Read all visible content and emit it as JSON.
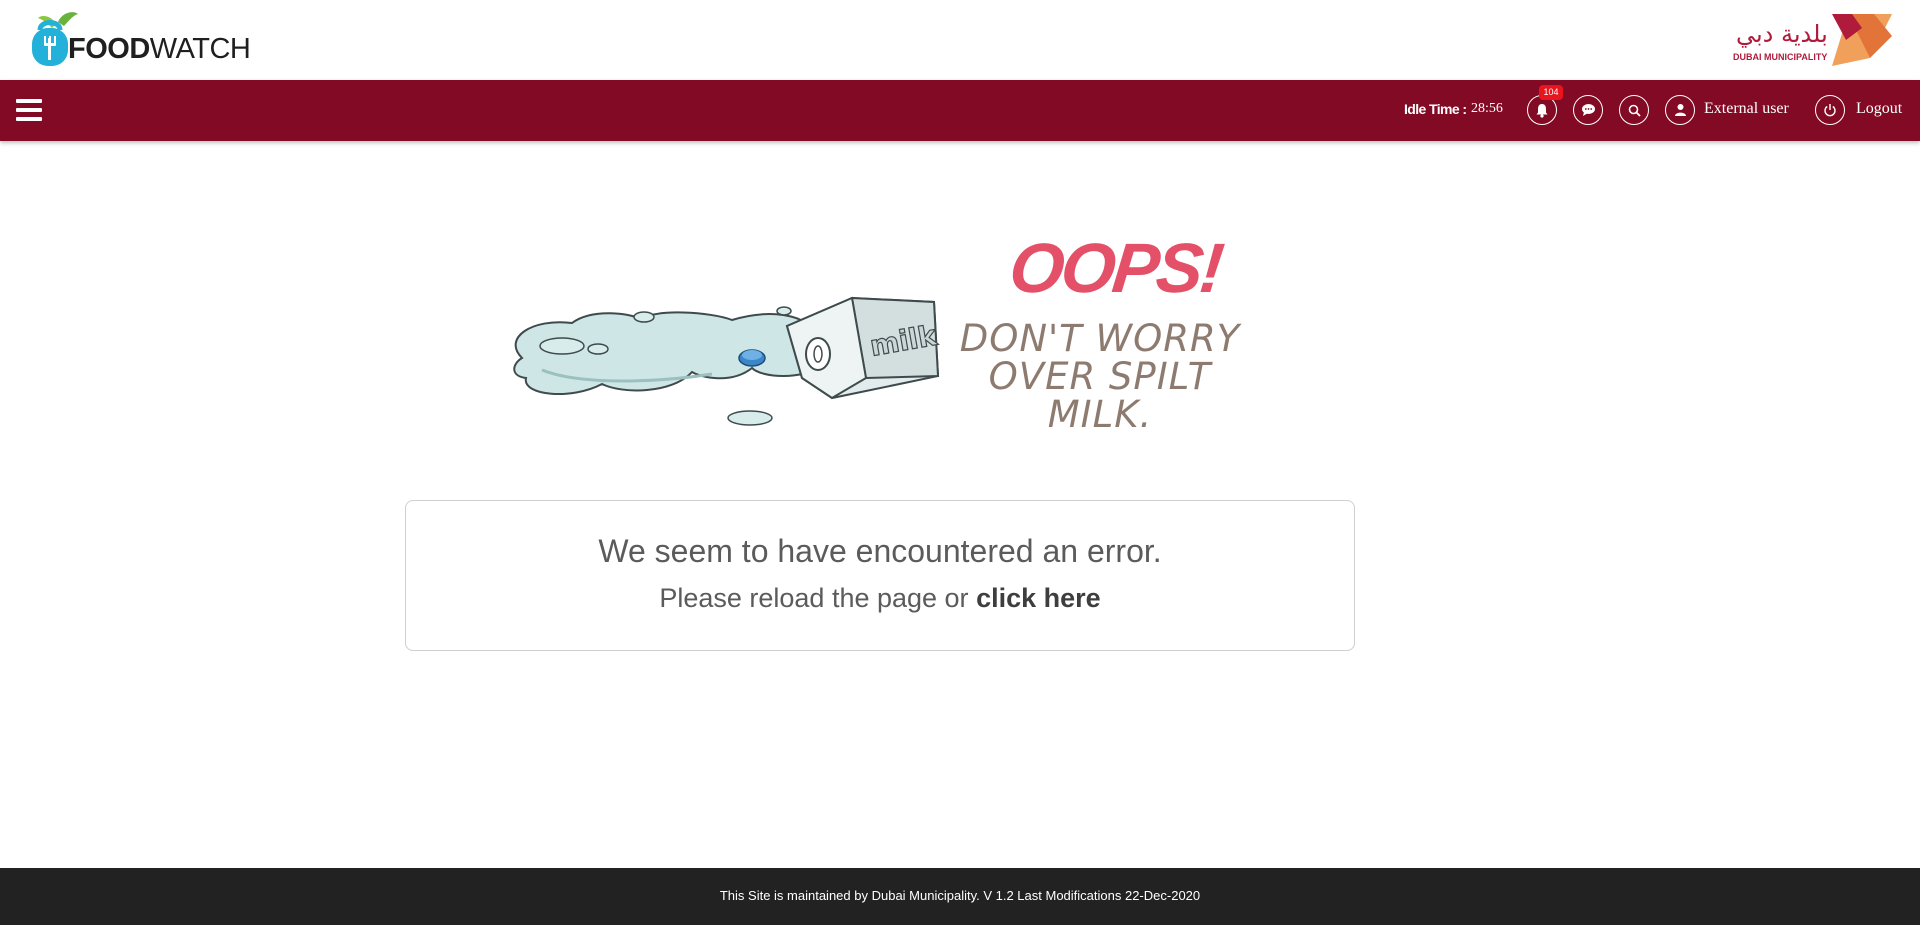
{
  "brand": {
    "logo_bold": "FOOD",
    "logo_light": "WATCH",
    "partner_arabic": "بلدية دبي",
    "partner_english": "DUBAI MUNICIPALITY"
  },
  "nav": {
    "idle_label": "Idle Time :",
    "idle_value": "28:56",
    "notification_count": "104",
    "user_label": "External user",
    "logout_label": "Logout",
    "icons": [
      "menu-icon",
      "bell-icon",
      "chat-icon",
      "search-icon",
      "user-icon",
      "power-icon"
    ]
  },
  "hero": {
    "headline": "OOPS!",
    "tagline_line1": "DON'T WORRY",
    "tagline_line2": "OVER SPILT MILK.",
    "carton_label": "milk"
  },
  "error": {
    "title": "We seem to have encountered an error.",
    "line_prefix": "Please reload the page or",
    "link_text": "click here"
  },
  "footer": {
    "text": "This Site is maintained by Dubai Municipality. V 1.2 Last Modifications 22-Dec-2020"
  },
  "colors": {
    "nav_background": "#820a24",
    "footer_background": "#222222",
    "oops_red": "#e35068",
    "tagline_brown": "#8e7b70",
    "badge_red": "#e8141e"
  }
}
